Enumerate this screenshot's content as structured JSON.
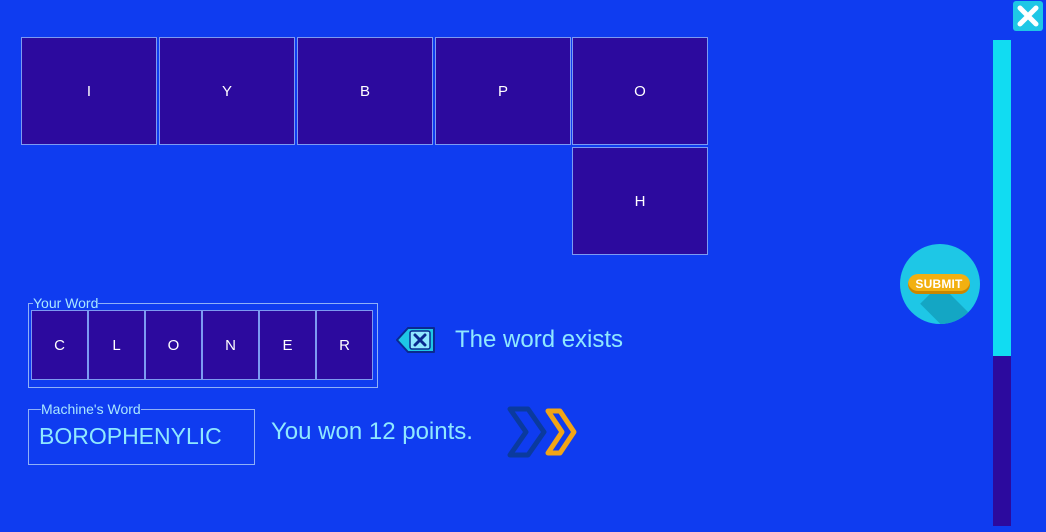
{
  "grid": {
    "tiles": [
      "I",
      "Y",
      "B",
      "P",
      "O",
      "H"
    ]
  },
  "your_word": {
    "legend": "Your Word",
    "letters": [
      "C",
      "L",
      "O",
      "N",
      "E",
      "R"
    ]
  },
  "status": "The word exists",
  "machine_word": {
    "legend": "Machine's Word",
    "word": "BOROPHENYLIC"
  },
  "result": "You won 12 points.",
  "submit_label": "SUBMIT",
  "timer": {
    "remaining_fraction": 0.65
  },
  "icons": {
    "close": "close-icon",
    "backspace": "backspace-icon",
    "next": "double-chevron-right-icon"
  },
  "colors": {
    "background": "#0f3cf0",
    "tile": "#2c0a9e",
    "timer_fill": "#11dcf2",
    "submit": "#1ec7e6",
    "submit_pill": "#f2b010",
    "text_accent": "#8fe8ff",
    "next_chevron": "#f2a516"
  }
}
